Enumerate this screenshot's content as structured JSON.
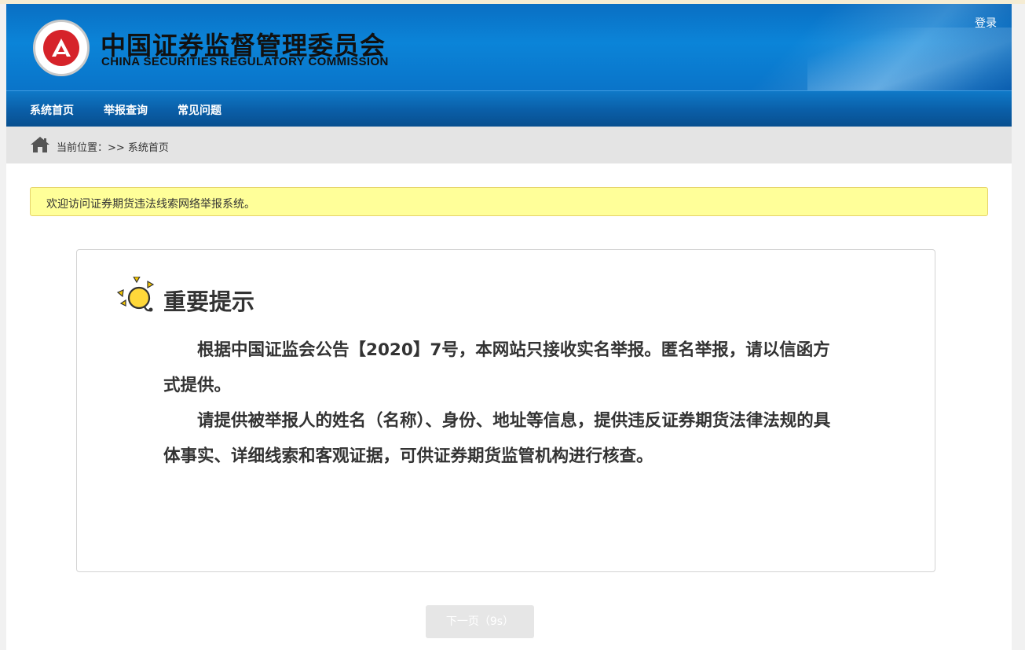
{
  "header": {
    "brand_cn": "中国证券监督管理委员会",
    "brand_en": "CHINA SECURITIES REGULATORY COMMISSION",
    "login_label": "登录",
    "logo_icon": "csrc-emblem-logo"
  },
  "nav": {
    "items": [
      {
        "label": "系统首页"
      },
      {
        "label": "举报查询"
      },
      {
        "label": "常见问题"
      }
    ]
  },
  "breadcrumb": {
    "icon": "home-icon",
    "text": "当前位置：>> 系统首页"
  },
  "notice": {
    "text": "欢迎访问证券期货违法线索网络举报系统。"
  },
  "tip": {
    "icon": "lightbulb-icon",
    "title": "重要提示",
    "paragraphs": [
      "根据中国证监会公告【2020】7号，本网站只接收实名举报。匿名举报，请以信函方式提供。",
      "请提供被举报人的姓名（名称）、身份、地址等信息，提供违反证券期货法律法规的具体事实、详细线索和客观证据，可供证券期货监管机构进行核查。"
    ]
  },
  "next_button": {
    "label": "下一页（9s）"
  },
  "colors": {
    "header_blue": "#0b84d8",
    "nav_blue": "#0a5ea7",
    "notice_yellow": "#ffff99",
    "logo_red": "#d6232a"
  }
}
